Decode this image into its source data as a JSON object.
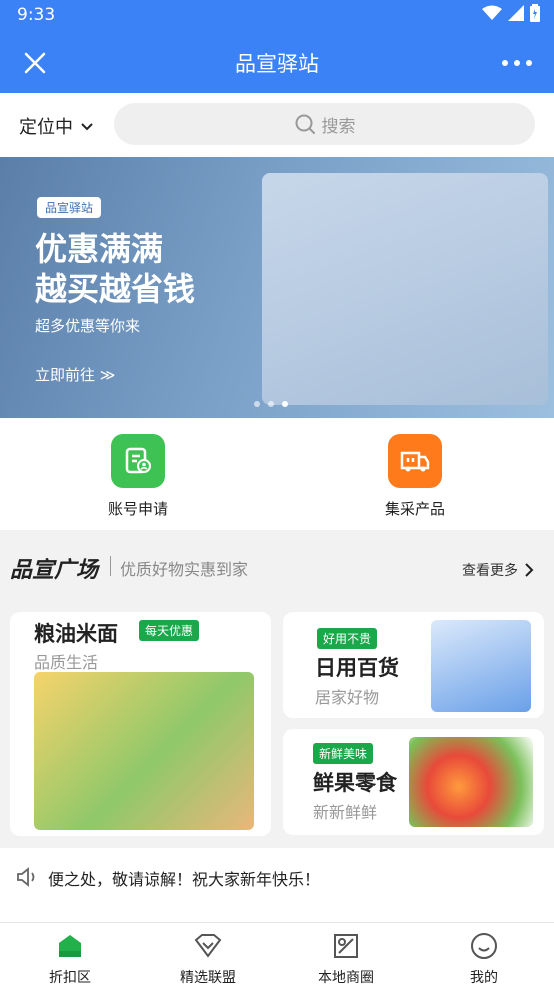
{
  "status": {
    "time": "9:33"
  },
  "header": {
    "title": "品宣驿站"
  },
  "location": {
    "label": "定位中"
  },
  "search": {
    "placeholder": "搜索"
  },
  "banner": {
    "tag": "品宣驿站",
    "headline_1": "优惠满满",
    "headline_2": "越买越省钱",
    "subtitle": "超多优惠等你来",
    "cta": "立即前往 ≫",
    "dots": 3,
    "active_dot": 3
  },
  "quick": [
    {
      "label": "账号申请",
      "color": "#3ec253"
    },
    {
      "label": "集采产品",
      "color": "#ff7a1a"
    }
  ],
  "plaza": {
    "title": "品宣广场",
    "subtitle": "优质好物实惠到家",
    "more": "查看更多",
    "cards": [
      {
        "title": "粮油米面",
        "badge": "每天优惠",
        "subtitle": "品质生活"
      },
      {
        "title": "日用百货",
        "badge": "好用不贵",
        "subtitle": "居家好物"
      },
      {
        "title": "鲜果零食",
        "badge": "新鲜美味",
        "subtitle": "新新鲜鲜"
      }
    ]
  },
  "notice": {
    "text": "便之处，敬请谅解！祝大家新年快乐！"
  },
  "tabs": [
    {
      "label": "折扣区",
      "active": true
    },
    {
      "label": "精选联盟"
    },
    {
      "label": "本地商圈"
    },
    {
      "label": "我的"
    }
  ],
  "colors": {
    "primary": "#3b82f6",
    "green": "#1aa84a"
  }
}
